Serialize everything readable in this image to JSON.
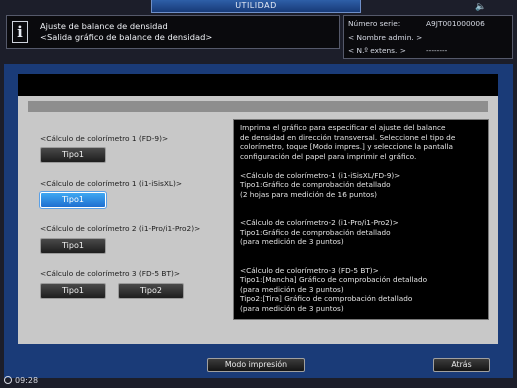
{
  "mode_tab": "UTILIDAD",
  "header": {
    "title_line1": "Ajuste de balance de densidad",
    "title_line2": "<Salida gráfico de balance de densidad>",
    "serial_label": "Número serie:",
    "serial_value": "A9JT001000006",
    "admin_name": "< Nombre admin. >",
    "ext_label": "< N.º extens. >",
    "ext_value": "--------"
  },
  "sections": [
    {
      "label": "<Cálculo de colorímetro 1 (FD-9)>",
      "buttons": [
        "Tipo1"
      ]
    },
    {
      "label": "<Cálculo de colorímetro 1 (i1-iSisXL)>",
      "buttons": [
        "Tipo1"
      ]
    },
    {
      "label": "<Cálculo de colorímetro 2 (i1-Pro/i1-Pro2)>",
      "buttons": [
        "Tipo1"
      ]
    },
    {
      "label": "<Cálculo de colorímetro 3 (FD-5 BT)>",
      "buttons": [
        "Tipo1",
        "Tipo2"
      ]
    }
  ],
  "description": {
    "intro": [
      "Imprima el gráfico para especificar el ajuste del balance",
      "de densidad en dirección transversal. Seleccione el tipo de",
      "colorímetro, toque [Modo impres.] y seleccione la pantalla",
      "configuración del papel para imprimir el gráfico."
    ],
    "block1": [
      "<Cálculo de colorímetro-1 (i1-iSisXL/FD-9)>",
      "Tipo1:Gráfico de comprobación detallado",
      "(2 hojas para medición de 16 puntos)"
    ],
    "block2": [
      "<Cálculo de colorímetro-2 (i1-Pro/i1-Pro2)>",
      "Tipo1:Gráfico de comprobación detallado",
      "(para medición de 3 puntos)"
    ],
    "block3": [
      "<Cálculo de colorímetro-3 (FD-5 BT)>",
      "Tipo1:[Mancha] Gráfico de comprobación detallado",
      "(para medición de 3 puntos)",
      "Tipo2:[Tira] Gráfico de comprobación detallado",
      "(para medición de 3 puntos)"
    ]
  },
  "footer": {
    "print_mode": "Modo impresión",
    "back": "Atrás",
    "time": "09:28"
  }
}
